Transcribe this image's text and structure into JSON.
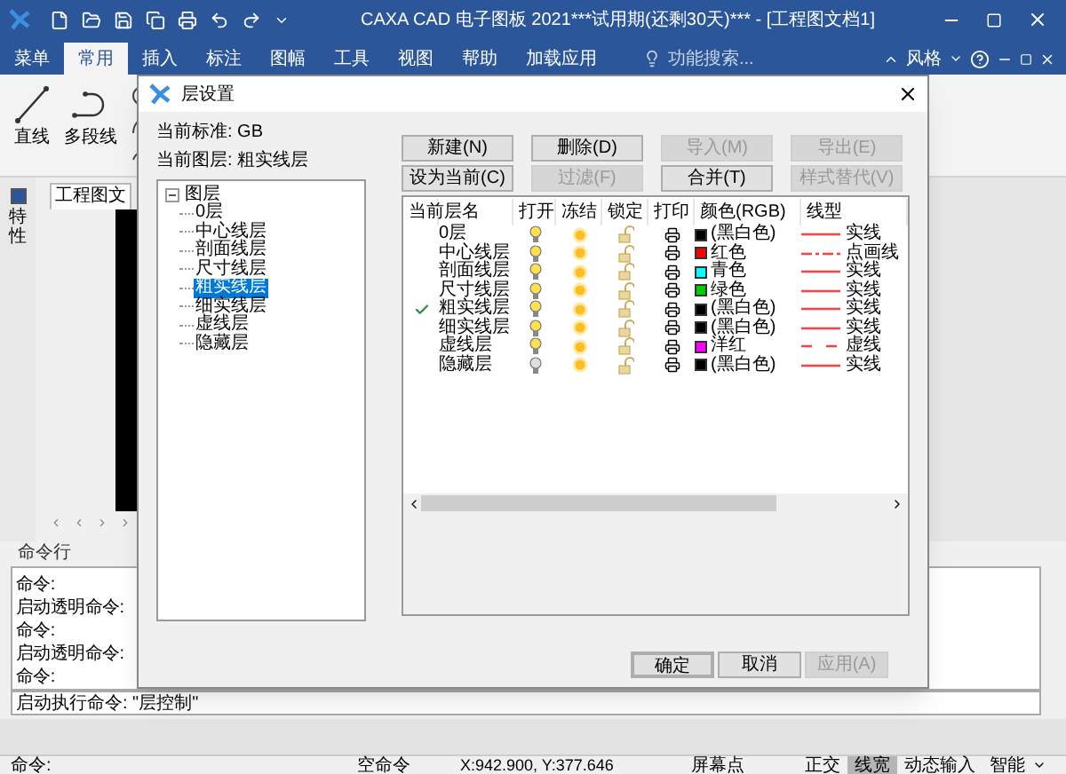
{
  "window": {
    "title": "CAXA CAD 电子图板 2021***试用期(还剩30天)*** - [工程图文档1]"
  },
  "menu_tabs": [
    {
      "label": "菜单",
      "selected": false
    },
    {
      "label": "常用",
      "selected": true
    },
    {
      "label": "插入",
      "selected": false
    },
    {
      "label": "标注",
      "selected": false
    },
    {
      "label": "图幅",
      "selected": false
    },
    {
      "label": "工具",
      "selected": false
    },
    {
      "label": "视图",
      "selected": false
    },
    {
      "label": "帮助",
      "selected": false
    },
    {
      "label": "加载应用",
      "selected": false
    }
  ],
  "search": {
    "placeholder": "功能搜索..."
  },
  "style_menu": "风格",
  "ribbon": {
    "tools": [
      "直线",
      "多段线"
    ]
  },
  "side_panel_tab": "特性",
  "document_tab": "工程图文",
  "command_panel": {
    "title": "命令行",
    "lines": [
      "命令:",
      "启动透明命令:",
      "命令:",
      "启动透明命令:",
      "命令:"
    ],
    "input": "启动执行命令: \"层控制\""
  },
  "dialog": {
    "title": "层设置",
    "current_standard": "当前标准: GB",
    "current_layer": "当前图层: 粗实线层",
    "tree": {
      "label": "图层",
      "expanded": true,
      "children": [
        {
          "label": "0层",
          "selected": false
        },
        {
          "label": "中心线层",
          "selected": false
        },
        {
          "label": "剖面线层",
          "selected": false
        },
        {
          "label": "尺寸线层",
          "selected": false
        },
        {
          "label": "粗实线层",
          "selected": true
        },
        {
          "label": "细实线层",
          "selected": false
        },
        {
          "label": "虚线层",
          "selected": false
        },
        {
          "label": "隐藏层",
          "selected": false
        }
      ]
    },
    "buttons": [
      {
        "label": "新建(N)",
        "disabled": false
      },
      {
        "label": "删除(D)",
        "disabled": false
      },
      {
        "label": "导入(M)",
        "disabled": true
      },
      {
        "label": "导出(E)",
        "disabled": true
      },
      {
        "label": "设为当前(C)",
        "disabled": false
      },
      {
        "label": "过滤(F)",
        "disabled": true
      },
      {
        "label": "合并(T)",
        "disabled": false
      },
      {
        "label": "样式替代(V)",
        "disabled": true
      }
    ],
    "table": {
      "columns": [
        "当前",
        "层名",
        "打开",
        "冻结",
        "锁定",
        "打印",
        "颜色(RGB)",
        "线型"
      ],
      "rows": [
        {
          "current": false,
          "name": "0层",
          "on": true,
          "frozen": false,
          "locked": false,
          "color": "#000000",
          "color_name": "(黑白色)",
          "linetype": {
            "kind": "solid",
            "label": "实线"
          }
        },
        {
          "current": false,
          "name": "中心线层",
          "on": true,
          "frozen": false,
          "locked": false,
          "color": "#ff0000",
          "color_name": "红色",
          "linetype": {
            "kind": "dashdot",
            "label": "点画线"
          }
        },
        {
          "current": false,
          "name": "剖面线层",
          "on": true,
          "frozen": false,
          "locked": false,
          "color": "#00ffff",
          "color_name": "青色",
          "linetype": {
            "kind": "solid",
            "label": "实线"
          }
        },
        {
          "current": false,
          "name": "尺寸线层",
          "on": true,
          "frozen": false,
          "locked": false,
          "color": "#00cc00",
          "color_name": "绿色",
          "linetype": {
            "kind": "solid",
            "label": "实线"
          }
        },
        {
          "current": true,
          "name": "粗实线层",
          "on": true,
          "frozen": false,
          "locked": false,
          "color": "#000000",
          "color_name": "(黑白色)",
          "linetype": {
            "kind": "solid",
            "label": "实线"
          }
        },
        {
          "current": false,
          "name": "细实线层",
          "on": true,
          "frozen": false,
          "locked": false,
          "color": "#000000",
          "color_name": "(黑白色)",
          "linetype": {
            "kind": "solid",
            "label": "实线"
          }
        },
        {
          "current": false,
          "name": "虚线层",
          "on": true,
          "frozen": false,
          "locked": false,
          "color": "#ff00ff",
          "color_name": "洋红",
          "linetype": {
            "kind": "dashed",
            "label": "虚线"
          }
        },
        {
          "current": false,
          "name": "隐藏层",
          "on": false,
          "frozen": false,
          "locked": false,
          "color": "#000000",
          "color_name": "(黑白色)",
          "linetype": {
            "kind": "solid",
            "label": "实线"
          }
        }
      ]
    },
    "footer_buttons": [
      {
        "label": "确定",
        "disabled": false,
        "default": true
      },
      {
        "label": "取消",
        "disabled": false,
        "default": false
      },
      {
        "label": "应用(A)",
        "disabled": true,
        "default": false
      }
    ]
  },
  "status_bar": {
    "command": "命令:",
    "state": "空命令",
    "coords": "X:942.900, Y:377.646",
    "snap": "屏幕点",
    "toggles": [
      {
        "label": "正交",
        "selected": false
      },
      {
        "label": "线宽",
        "selected": true
      },
      {
        "label": "动态输入",
        "selected": false
      },
      {
        "label": "智能",
        "selected": false
      }
    ]
  }
}
